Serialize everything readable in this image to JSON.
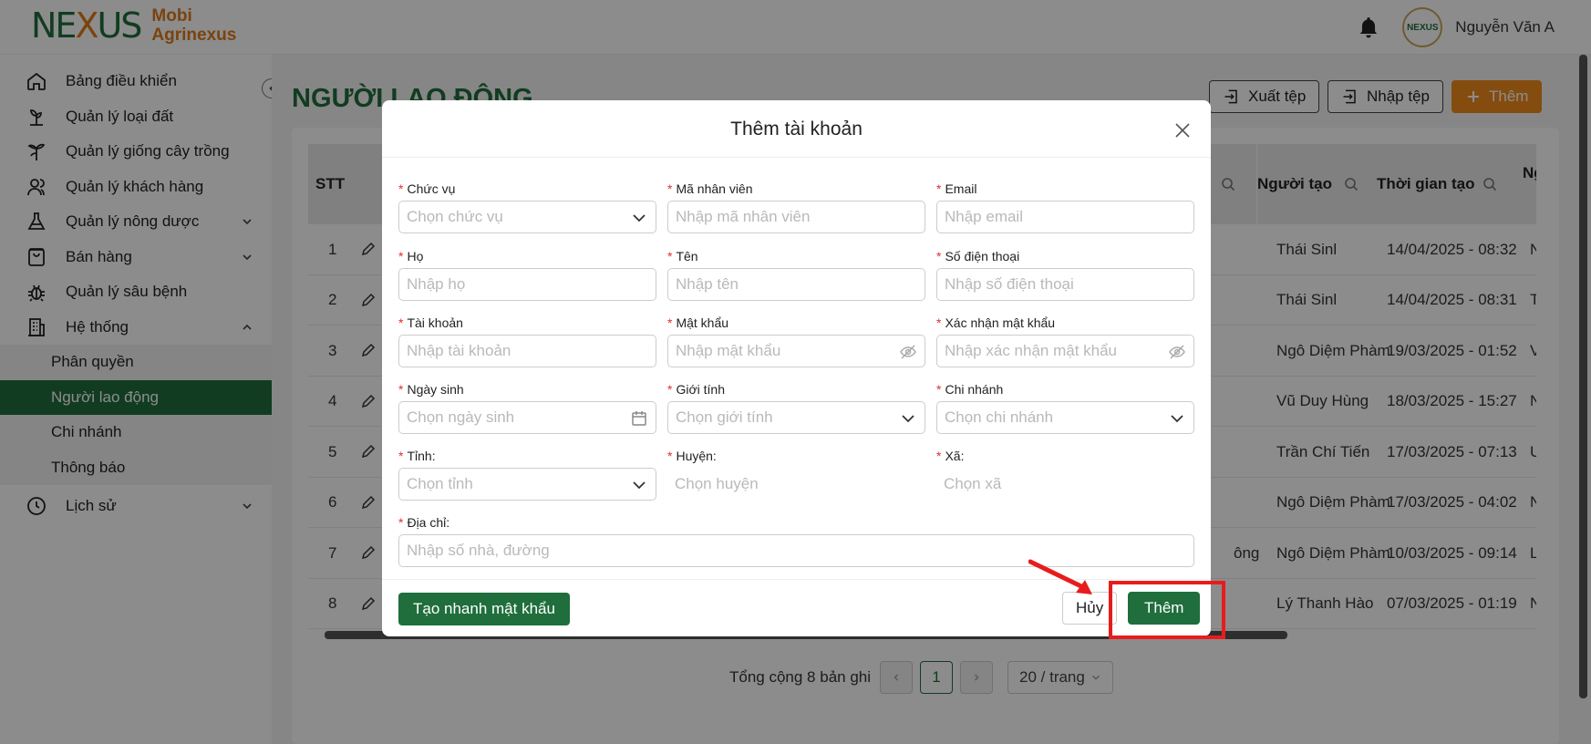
{
  "brand": {
    "mark_left": "NE",
    "mark_x": "X",
    "mark_right": "US",
    "line1": "Mobi",
    "line2": "Agrinexus",
    "avatar_text": "NEXUS"
  },
  "user": {
    "name": "Nguyễn Văn A"
  },
  "sidebar": {
    "items": [
      {
        "label": "Bảng điều khiển",
        "icon": "home-icon"
      },
      {
        "label": "Quản lý loại đất",
        "icon": "sprout-icon"
      },
      {
        "label": "Quản lý giống cây trồng",
        "icon": "plant-icon"
      },
      {
        "label": "Quản lý khách hàng",
        "icon": "user-icon"
      },
      {
        "label": "Quản lý nông dược",
        "icon": "flask-icon"
      },
      {
        "label": "Bán hàng",
        "icon": "bag-icon"
      },
      {
        "label": "Quản lý sâu bệnh",
        "icon": "bug-icon"
      },
      {
        "label": "Hệ thống",
        "icon": "building-icon"
      }
    ],
    "sub_items": [
      "Phân quyền",
      "Người lao động",
      "Chi nhánh",
      "Thông báo"
    ],
    "history": {
      "label": "Lịch sử",
      "icon": "clock-icon"
    }
  },
  "page": {
    "title": "NGƯỜI LAO ĐỘNG",
    "export_label": "Xuất tệp",
    "import_label": "Nhập tệp",
    "add_label": "Thêm"
  },
  "table": {
    "headers": {
      "stt": "STT",
      "creator": "Người tạo",
      "created_time": "Thời gian tạo",
      "next": "Ng"
    },
    "rows": [
      {
        "stt": "1",
        "partial": "",
        "creator": "Thái Sinl",
        "time": "14/04/2025 - 08:32",
        "next": "Ngu"
      },
      {
        "stt": "2",
        "partial": "",
        "creator": "Thái Sinl",
        "time": "14/04/2025 - 08:31",
        "next": "Thái"
      },
      {
        "stt": "3",
        "partial": "",
        "creator": "Ngô Diệm Phàm",
        "time": "19/03/2025 - 01:52",
        "next": "Vũ D"
      },
      {
        "stt": "4",
        "partial": "",
        "creator": "Vũ Duy Hùng",
        "time": "18/03/2025 - 15:27",
        "next": "Ngô"
      },
      {
        "stt": "5",
        "partial": "",
        "creator": "Trần Chí Tiến",
        "time": "17/03/2025 - 07:13",
        "next": "Ung"
      },
      {
        "stt": "6",
        "partial": "",
        "creator": "Ngô Diệm Phàm",
        "time": "17/03/2025 - 04:02",
        "next": "Ngu"
      },
      {
        "stt": "7",
        "partial": "ông",
        "creator": "Ngô Diệm Phàm",
        "time": "10/03/2025 - 09:14",
        "next": "Lý T"
      },
      {
        "stt": "8",
        "partial": "",
        "creator": "Lý Thanh Hào",
        "time": "07/03/2025 - 01:19",
        "next": "Ngô"
      }
    ]
  },
  "pagination": {
    "total": "Tổng cộng 8 bản ghi",
    "current": "1",
    "page_size": "20 / trang"
  },
  "modal": {
    "title": "Thêm tài khoản",
    "fields": {
      "position": {
        "label": "Chức vụ",
        "placeholder": "Chọn chức vụ"
      },
      "employee_code": {
        "label": "Mã nhân viên",
        "placeholder": "Nhập mã nhân viên"
      },
      "email": {
        "label": "Email",
        "placeholder": "Nhập email"
      },
      "last_name": {
        "label": "Họ",
        "placeholder": "Nhập họ"
      },
      "first_name": {
        "label": "Tên",
        "placeholder": "Nhập tên"
      },
      "phone": {
        "label": "Số điện thoại",
        "placeholder": "Nhập số điện thoại"
      },
      "account": {
        "label": "Tài khoản",
        "placeholder": "Nhập tài khoản"
      },
      "password": {
        "label": "Mật khẩu",
        "placeholder": "Nhập mật khẩu"
      },
      "confirm_password": {
        "label": "Xác nhận mật khẩu",
        "placeholder": "Nhập xác nhận mật khẩu"
      },
      "birthday": {
        "label": "Ngày sinh",
        "placeholder": "Chọn ngày sinh"
      },
      "gender": {
        "label": "Giới tính",
        "placeholder": "Chọn giới tính"
      },
      "branch": {
        "label": "Chi nhánh",
        "placeholder": "Chọn chi nhánh"
      },
      "province": {
        "label": "Tỉnh:",
        "placeholder": "Chọn tỉnh"
      },
      "district": {
        "label": "Huyện:",
        "placeholder": "Chọn huyện"
      },
      "ward": {
        "label": "Xã:",
        "placeholder": "Chọn xã"
      },
      "address": {
        "label": "Địa chỉ:",
        "placeholder": "Nhập số nhà, đường"
      }
    },
    "required_mark": "*",
    "generate_password_label": "Tạo nhanh mật khẩu",
    "cancel_label": "Hủy",
    "submit_label": "Thêm"
  },
  "colors": {
    "brand_green": "#1f6e3c",
    "brand_orange": "#f08a1c",
    "highlight_red": "#e81c1c"
  }
}
